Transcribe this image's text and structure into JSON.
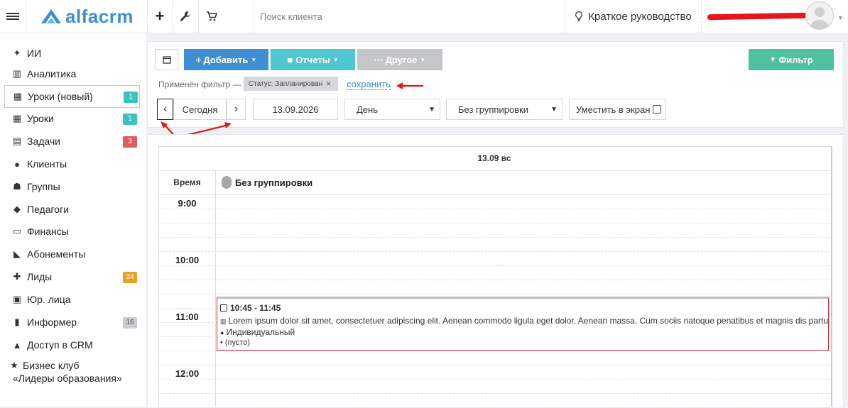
{
  "topbar": {
    "logo": "alfacrm",
    "search_placeholder": "Поиск клиента",
    "guide_label": "Краткое руководство"
  },
  "sidebar": {
    "items": [
      {
        "label": "ИИ",
        "icon": "sparkle-icon"
      },
      {
        "label": "Аналитика",
        "icon": "map-icon"
      },
      {
        "label": "Уроки (новый)",
        "icon": "calendar-icon",
        "badge": "1",
        "badge_color": "#39c3c3",
        "active": true
      },
      {
        "label": "Уроки",
        "icon": "calendar-icon",
        "badge": "1",
        "badge_color": "#39c3c3"
      },
      {
        "label": "Задачи",
        "icon": "clipboard-icon",
        "badge": "3",
        "badge_color": "#e25b5b"
      },
      {
        "label": "Клиенты",
        "icon": "user-icon"
      },
      {
        "label": "Группы",
        "icon": "users-icon"
      },
      {
        "label": "Педагоги",
        "icon": "graduation-cap-icon"
      },
      {
        "label": "Финансы",
        "icon": "money-icon"
      },
      {
        "label": "Абонементы",
        "icon": "tag-icon"
      },
      {
        "label": "Лиды",
        "icon": "user-plus-icon",
        "badge": "24",
        "badge_color": "#f0a020"
      },
      {
        "label": "Юр. лица",
        "icon": "briefcase-icon"
      },
      {
        "label": "Информер",
        "icon": "tablet-icon",
        "badge": "16",
        "badge_color": "#c9cdd2"
      },
      {
        "label": "Доступ в CRM",
        "icon": "lock-icon"
      },
      {
        "label": "Бизнес клуб",
        "label2": "«Лидеры образования»",
        "icon": "star-icon"
      }
    ]
  },
  "toolbar": {
    "add_label": "Добавить",
    "reports_label": "Отчеты",
    "other_label": "Другое",
    "filter_label": "Фильтр",
    "applied_filter_label": "Применён фильтр —",
    "filter_chip": "Статус: Запланирован",
    "save_link": "сохранить",
    "today_label": "Сегодня",
    "date_value": "13.09.2026",
    "view_select": "День",
    "grouping_select": "Без группировки",
    "fit_label": "Уместить в экран"
  },
  "calendar": {
    "day_header": "13.09 вс",
    "time_col": "Время",
    "group_col": "Без группировки",
    "hours": [
      "9:00",
      "10:00",
      "11:00",
      "12:00"
    ],
    "event": {
      "time": "10:45 - 11:45",
      "description": "Lorem ipsum dolor sit amet, consectetuer adipiscing elit. Aenean commodo ligula eget dolor. Aenean massa. Cum sociis natoque penatibus et magnis dis parturient montes",
      "type": "Индивидуальный",
      "extra": "(пусто)"
    }
  },
  "colors": {
    "add": "#3f8fd2",
    "reports": "#4fc7d1",
    "other": "#c4c6ca",
    "filter": "#4fc1a1",
    "annotation_red": "#e01a1a"
  }
}
